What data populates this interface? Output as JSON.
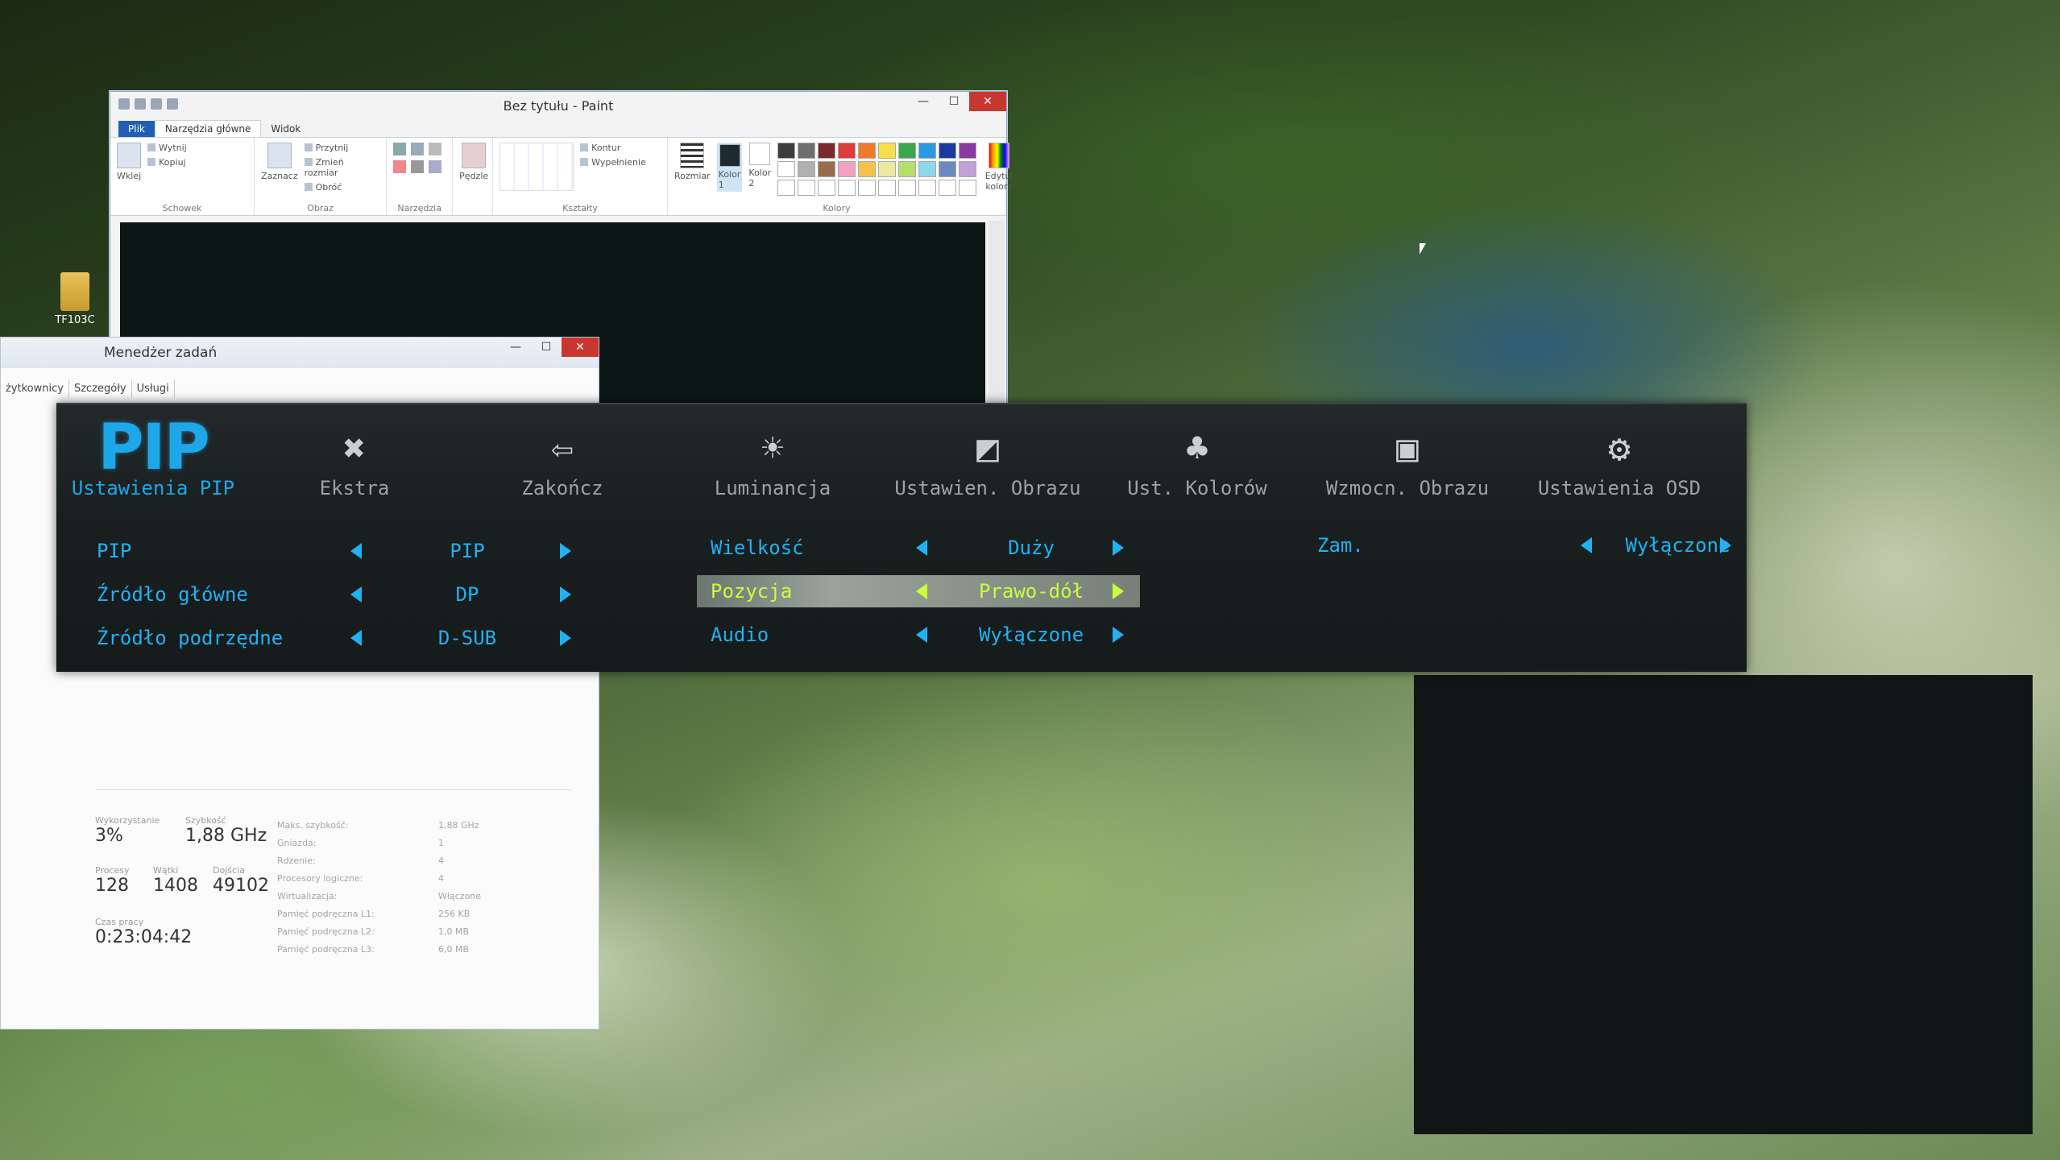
{
  "desktop": {
    "icon_label": "TF103C"
  },
  "paint": {
    "title": "Bez tytułu - Paint",
    "tabs": {
      "file": "Plik",
      "home": "Narzędzia główne",
      "view": "Widok"
    },
    "clipboard": {
      "paste": "Wklej",
      "cut": "Wytnij",
      "copy": "Kopiuj",
      "group": "Schowek"
    },
    "image": {
      "select": "Zaznacz",
      "crop": "Przytnij",
      "resize": "Zmień rozmiar",
      "rotate": "Obróć",
      "group": "Obraz"
    },
    "tools": {
      "group": "Narzędzia"
    },
    "brushes": {
      "label": "Pędzle"
    },
    "shapes": {
      "outline": "Kontur",
      "fill": "Wypełnienie",
      "group": "Kształty"
    },
    "size": {
      "label": "Rozmiar"
    },
    "colors": {
      "color1": "Kolor 1",
      "color2": "Kolor 2",
      "edit": "Edytuj kolory",
      "group": "Kolory"
    },
    "palette": [
      "#3c3c3c",
      "#6e6e6e",
      "#7a2a2a",
      "#e03a3a",
      "#f07a2a",
      "#f6e04a",
      "#3aa84a",
      "#2a9ae0",
      "#1a3aa0",
      "#8a3aa0",
      "#ffffff",
      "#b0b0b0",
      "#9a6a4a",
      "#f4a0c0",
      "#f6c04a",
      "#eee8a0",
      "#b4e06a",
      "#8ad8e8",
      "#6a8ac0",
      "#c0a0d8",
      "#ffffff",
      "#ffffff",
      "#ffffff",
      "#ffffff",
      "#ffffff",
      "#ffffff",
      "#ffffff",
      "#ffffff",
      "#ffffff",
      "#ffffff"
    ]
  },
  "taskmgr": {
    "title": "Menedżer zadań",
    "tabs": [
      "żytkownicy",
      "Szczegóły",
      "Usługi"
    ],
    "utilization": {
      "label": "Wykorzystanie",
      "value": "3%"
    },
    "speed": {
      "label": "Szybkość",
      "value": "1,88 GHz"
    },
    "processes": {
      "label": "Procesy",
      "value": "128"
    },
    "threads": {
      "label": "Wątki",
      "value": "1408"
    },
    "handles": {
      "label": "Dojścia",
      "value": "49102"
    },
    "uptime": {
      "label": "Czas pracy",
      "value": "0:23:04:42"
    },
    "right": [
      {
        "k": "Maks. szybkość:",
        "v": "1,88 GHz"
      },
      {
        "k": "Gniazda:",
        "v": "1"
      },
      {
        "k": "Rdzenie:",
        "v": "4"
      },
      {
        "k": "Procesory logiczne:",
        "v": "4"
      },
      {
        "k": "Wirtualizacja:",
        "v": "Włączone"
      },
      {
        "k": "Pamięć podręczna L1:",
        "v": "256 KB"
      },
      {
        "k": "Pamięć podręczna L2:",
        "v": "1,0 MB"
      },
      {
        "k": "Pamięć podręczna L3:",
        "v": "6,0 MB"
      }
    ]
  },
  "osd": {
    "tabs": [
      {
        "icon": "PIP",
        "label": "Ustawienia PIP"
      },
      {
        "icon": "tools-icon",
        "label": "Ekstra"
      },
      {
        "icon": "exit-icon",
        "label": "Zakończ"
      },
      {
        "icon": "brightness-icon",
        "label": "Luminancja"
      },
      {
        "icon": "image-settings-icon",
        "label": "Ustawien. Obrazu"
      },
      {
        "icon": "color-icon",
        "label": "Ust. Kolorów"
      },
      {
        "icon": "enhance-icon",
        "label": "Wzmocn. Obrazu"
      },
      {
        "icon": "osd-settings-icon",
        "label": "Ustawienia OSD"
      }
    ],
    "col1": [
      {
        "label": "PIP",
        "value": "PIP"
      },
      {
        "label": "Źródło główne",
        "value": "DP"
      },
      {
        "label": "Źródło podrzędne",
        "value": "D-SUB"
      }
    ],
    "col2": [
      {
        "label": "Wielkość",
        "value": "Duży"
      },
      {
        "label": "Pozycja",
        "value": "Prawo-dół"
      },
      {
        "label": "Audio",
        "value": "Wyłączone"
      }
    ],
    "col3": [
      {
        "label": "Zam.",
        "value": "Wyłączone"
      }
    ],
    "accent": "#1fb2f2",
    "selected_color": "#c8ff3a"
  }
}
